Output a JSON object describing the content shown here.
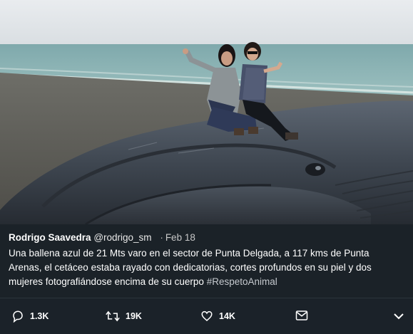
{
  "tweet": {
    "display_name": "Rodrigo Saavedra",
    "handle": "@rodrigo_sm",
    "separator": "·",
    "date": "Feb 18",
    "text": "Una ballena azul de 21 Mts varo en el sector de Punta Delgada, a 117 kms de Punta Arenas, el cetáceo estaba rayado con dedicatorias, cortes profundos en su piel y dos mujeres fotografiándose encima de su cuerpo",
    "hashtag": "#RespetoAnimal"
  },
  "actions": {
    "reply": {
      "icon": "reply-icon",
      "count": "1.3K"
    },
    "retweet": {
      "icon": "retweet-icon",
      "count": "19K"
    },
    "like": {
      "icon": "heart-icon",
      "count": "14K"
    },
    "message": {
      "icon": "envelope-icon"
    },
    "more": {
      "icon": "chevron-down-icon"
    }
  },
  "colors": {
    "card_bg": "#15202b",
    "caption_bg": "#1c2228",
    "text": "#ffffff",
    "hashtag": "#c5c9ce",
    "icon": "#ffffff"
  }
}
